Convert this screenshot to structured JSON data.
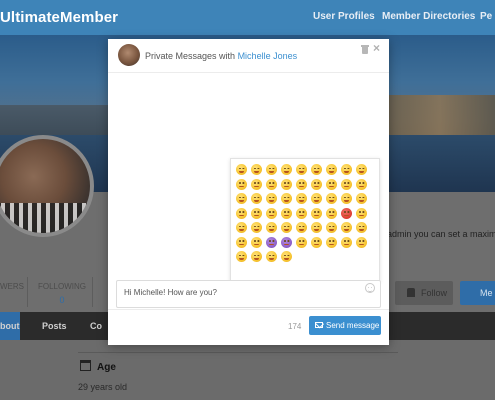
{
  "site": {
    "logo": "UltimateMember",
    "nav": [
      {
        "label": "User Profiles"
      },
      {
        "label": "Member Directories"
      },
      {
        "label": "Pe"
      }
    ]
  },
  "profile": {
    "stats": [
      {
        "label": "WERS",
        "value": ""
      },
      {
        "label": "FOLLOWING",
        "value": "0"
      },
      {
        "label": "",
        "value": ""
      }
    ],
    "bio_fragment": "admin you can set a maxim",
    "follow_label": "Follow",
    "message_label": "Me",
    "tabs": [
      {
        "label": "bout",
        "active": true
      },
      {
        "label": "Posts",
        "active": false
      },
      {
        "label": "Co",
        "active": false
      }
    ],
    "field_label": "Age",
    "field_value": "29 years old"
  },
  "modal": {
    "title_prefix": "Private Messages with",
    "recipient": "Michelle Jones",
    "input_value": "Hi Michelle! How are you?",
    "char_count": "174",
    "send_label": "Send message",
    "emoji_rows": [
      [
        "yellow",
        "yellow",
        "yellow",
        "yellow",
        "yellow",
        "yellow",
        "yellow",
        "yellow",
        "yellow"
      ],
      [
        "yellow",
        "yellow",
        "yellow",
        "yellow",
        "yellow",
        "yellow",
        "yellow",
        "yellow",
        "yellow"
      ],
      [
        "yellow",
        "yellow",
        "yellow",
        "yellow",
        "yellow",
        "yellow",
        "yellow",
        "yellow",
        "yellow"
      ],
      [
        "yellow",
        "yellow",
        "yellow",
        "yellow",
        "yellow",
        "yellow",
        "yellow",
        "red",
        "yellow"
      ],
      [
        "yellow",
        "yellow",
        "yellow",
        "yellow",
        "yellow",
        "yellow",
        "yellow",
        "yellow",
        "yellow"
      ],
      [
        "yellow",
        "yellow",
        "purple",
        "purple",
        "yellow",
        "yellow",
        "yellow",
        "yellow",
        "yellow"
      ],
      [
        "yellow",
        "yellow",
        "yellow",
        "yellow"
      ]
    ]
  },
  "colors": {
    "accent": "#3b8fd0",
    "topbar": "#3e84b8"
  }
}
